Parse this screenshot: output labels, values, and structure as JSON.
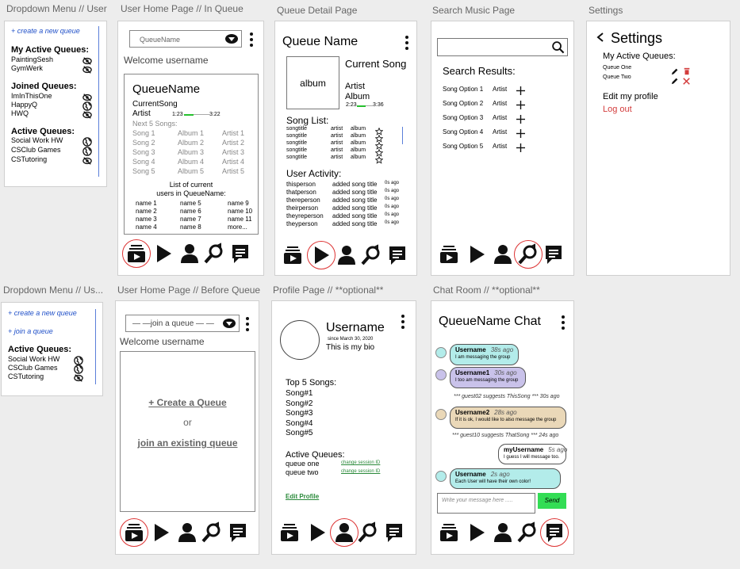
{
  "titles": {
    "f1": "Dropdown Menu // User",
    "f2": "User Home Page // In Queue",
    "f3": "Queue Detail Page",
    "f4": "Search Music Page",
    "f5": "Settings",
    "f6": "Dropdown Menu // Us...",
    "f7": "User Home Page // Before Queue",
    "f8": "Profile Page // **optional**",
    "f9": "Chat Room // **optional**"
  },
  "dd1": {
    "create": "+ create a new queue",
    "my_header": "My Active Queues:",
    "my": [
      "PaintingSesh",
      "GymWerk"
    ],
    "joined_header": "Joined Queues:",
    "joined": [
      "ImInThisOne",
      "HappyQ",
      "HWQ"
    ],
    "active_header": "Active Queues:",
    "active": [
      "Social Work HW",
      "CSClub Games",
      "CSTutoring"
    ]
  },
  "home_in": {
    "dropdown": "QueueName",
    "welcome": "Welcome username",
    "queue_name": "QueueName",
    "current_song": "CurrentSong",
    "artist": "Artist",
    "time_start": "1:23",
    "time_end": "3:22",
    "progress": 0.38,
    "next_label": "Next 5 Songs:",
    "songs": [
      [
        "Song 1",
        "Album 1",
        "Artist 1"
      ],
      [
        "Song 2",
        "Album 2",
        "Artist 2"
      ],
      [
        "Song 3",
        "Album 3",
        "Artist 3"
      ],
      [
        "Song 4",
        "Album 4",
        "Artist 4"
      ],
      [
        "Song 5",
        "Album 5",
        "Artist 5"
      ]
    ],
    "users_label_1": "List of current",
    "users_label_2": "users in QueueName:",
    "users": [
      [
        "name 1",
        "name 5",
        "name 9"
      ],
      [
        "name 2",
        "name 6",
        "name 10"
      ],
      [
        "name 3",
        "name 7",
        "name 11"
      ],
      [
        "name 4",
        "name 8",
        "more..."
      ]
    ]
  },
  "detail": {
    "queue_name": "Queue Name",
    "album": "album",
    "current_song": "Current Song",
    "artist": "Artist",
    "album_label": "Album",
    "time_start": "2:23",
    "time_end": "3:36",
    "progress": 0.55,
    "song_list_label": "Song List:",
    "songs": [
      [
        "songtitle",
        "artist",
        "album"
      ],
      [
        "songtitle",
        "artist",
        "album"
      ],
      [
        "songtitle",
        "artist",
        "album"
      ],
      [
        "songtitle",
        "artist",
        "album"
      ],
      [
        "songtitle",
        "artist",
        "album"
      ]
    ],
    "activity_label": "User Activity:",
    "activity": [
      [
        "thisperson",
        "added song title",
        "0s ago"
      ],
      [
        "thatperson",
        "added song title",
        "0s ago"
      ],
      [
        "thereperson",
        "added song title",
        "0s ago"
      ],
      [
        "theirperson",
        "added song title",
        "0s ago"
      ],
      [
        "theyreperson",
        "added song title",
        "0s ago"
      ],
      [
        "theyperson",
        "added song title",
        "0s ago"
      ]
    ]
  },
  "search": {
    "results_label": "Search Results:",
    "results": [
      [
        "Song Option 1",
        "Artist"
      ],
      [
        "Song Option 2",
        "Artist"
      ],
      [
        "Song Option 3",
        "Artist"
      ],
      [
        "Song Option 4",
        "Artist"
      ],
      [
        "Song Option 5",
        "Artist"
      ]
    ]
  },
  "settings": {
    "title": "Settings",
    "active_label": "My Active Queues:",
    "queues": [
      "Queue One",
      "Queue Two"
    ],
    "edit": "Edit my profile",
    "logout": "Log out",
    "accent_red": "#d33c3c"
  },
  "dd2": {
    "create": "+ create a new queue",
    "join": "+ join a queue",
    "active_header": "Active Queues:",
    "active": [
      "Social Work HW",
      "CSClub Games",
      "CSTutoring"
    ]
  },
  "home_before": {
    "dropdown": "— —join a queue — —",
    "welcome": "Welcome username",
    "create": "+ Create a Queue",
    "or": "or",
    "join": "join an existing queue"
  },
  "profile": {
    "username": "Username",
    "since": "since March 30, 2020",
    "bio": "This is my bio",
    "top_label": "Top 5 Songs:",
    "top": [
      "Song#1",
      "Song#2",
      "Song#3",
      "Song#4",
      "Song#5"
    ],
    "active_label": "Active Queues:",
    "queues": [
      [
        "queue one",
        "change session ID"
      ],
      [
        "queue two",
        "change session ID"
      ]
    ],
    "edit": "Edit Profile",
    "accent_green": "#2a8a3a"
  },
  "chat": {
    "title": "QueueName Chat",
    "messages": [
      {
        "user": "Username",
        "time": "38s ago",
        "text": "I am messaging the group",
        "color": "#b3ecea"
      },
      {
        "user": "Username1",
        "time": "30s ago",
        "text": "I too am messaging the group",
        "color": "#c9c2ea"
      },
      {
        "user": "Username2",
        "time": "28s ago",
        "text": "If it is ok, I would like to also message the group",
        "color": "#ead8b8"
      },
      {
        "user": "myUsername",
        "time": "5s ago",
        "text": "I guess I will message too.",
        "color": "#ffffff"
      },
      {
        "user": "Username",
        "time": "2s ago",
        "text": "Each User will have their own color!",
        "color": "#b3ecea"
      }
    ],
    "system1": "*** guest02 suggests ThisSong *** 30s ago",
    "system2": "*** guest10 suggests ThatSong *** 24s ago",
    "placeholder": "Write your message here .....",
    "send": "Send",
    "send_color": "#33dd55"
  },
  "icons": [
    "queue-icon",
    "play-icon",
    "user-icon",
    "search-icon",
    "chat-icon",
    "eye-slash-icon",
    "globe-icon",
    "star-icon",
    "plus-icon",
    "pencil-icon",
    "trash-icon",
    "x-icon",
    "chevron-left-icon",
    "kebab-icon"
  ]
}
